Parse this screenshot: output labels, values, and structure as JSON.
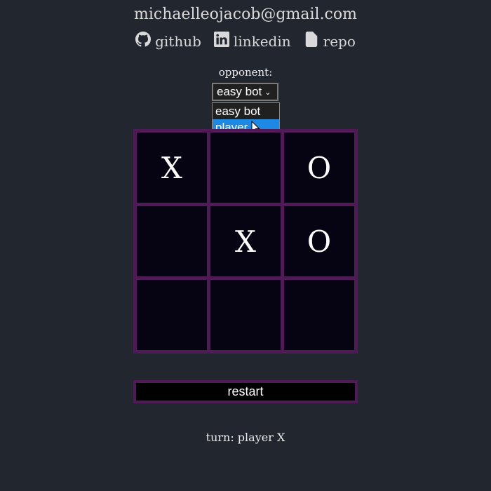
{
  "header": {
    "email": "michaelleojacob@gmail.com",
    "links": [
      {
        "label": "github",
        "icon": "github-icon"
      },
      {
        "label": "linkedin",
        "icon": "linkedin-icon"
      },
      {
        "label": "repo",
        "icon": "file-icon"
      }
    ]
  },
  "opponent": {
    "label": "opponent:",
    "selected": "easy bot",
    "options": [
      "easy bot",
      "player"
    ],
    "highlighted_option": "player"
  },
  "board": {
    "cells": [
      "X",
      "",
      "O",
      "",
      "X",
      "O",
      "",
      "",
      ""
    ]
  },
  "controls": {
    "restart_label": "restart"
  },
  "status": {
    "turn_text": "turn: player X"
  },
  "colors": {
    "background": "#22262f",
    "board_border": "#4f1a55",
    "cell": "#060412",
    "highlight": "#1e88e5"
  }
}
